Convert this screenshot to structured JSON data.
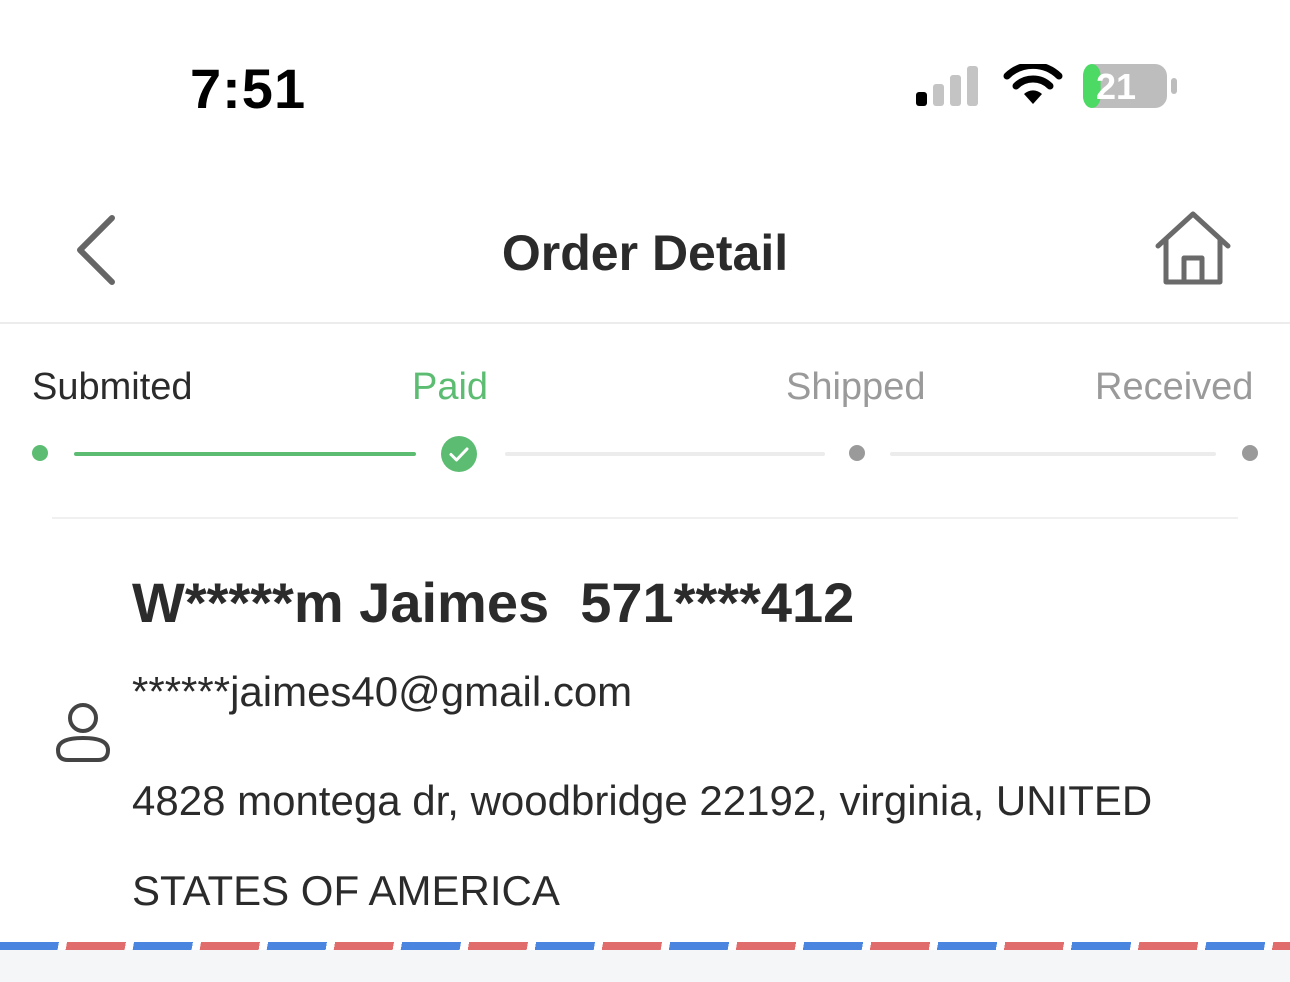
{
  "status_bar": {
    "time": "7:51",
    "battery_percent": "21",
    "battery_level": 0.21,
    "icons": [
      "cellular-signal-icon",
      "wifi-icon",
      "battery-charging-icon"
    ]
  },
  "nav": {
    "title": "Order Detail",
    "back_icon": "chevron-left-icon",
    "home_icon": "home-icon"
  },
  "progress": {
    "steps": [
      {
        "label": "Submited",
        "state": "done"
      },
      {
        "label": "Paid",
        "state": "current"
      },
      {
        "label": "Shipped",
        "state": "pending"
      },
      {
        "label": "Received",
        "state": "pending"
      }
    ],
    "colors": {
      "active": "#5cbd72",
      "inactive": "#9a9a9a",
      "track": "#ececec"
    }
  },
  "address_card": {
    "name": "W*****m Jaimes",
    "phone": "571****412",
    "email": "******jaimes40@gmail.com",
    "address": "4828 montega dr, woodbridge 22192, virginia, UNITED STATES OF AMERICA",
    "icon": "person-icon"
  },
  "airmail_colors": {
    "blue": "#4a86e0",
    "red": "#e06c6c"
  }
}
